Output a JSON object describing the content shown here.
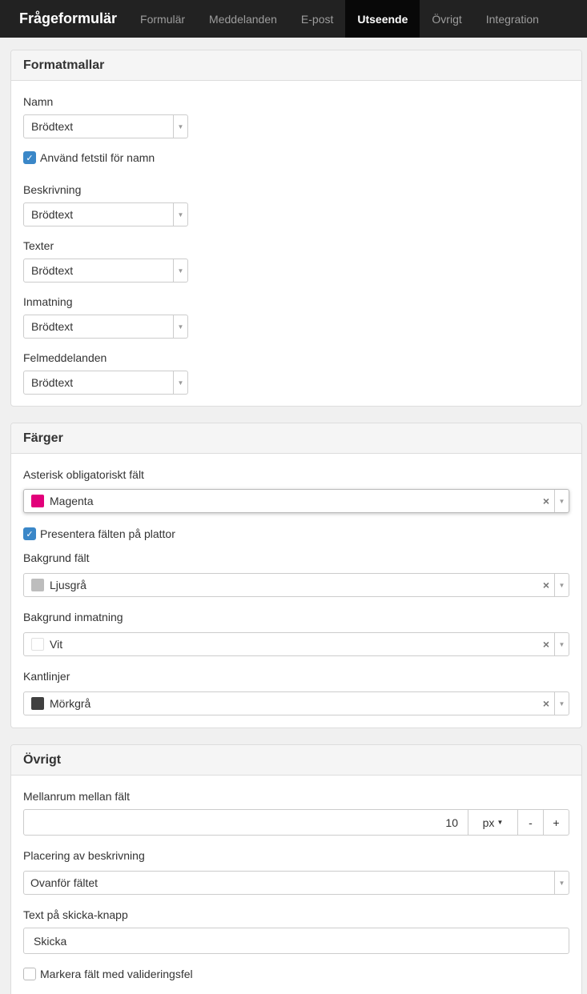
{
  "nav": {
    "brand": "Frågeformulär",
    "tabs": [
      "Formulär",
      "Meddelanden",
      "E-post",
      "Utseende",
      "Övrigt",
      "Integration"
    ]
  },
  "formatmallar": {
    "title": "Formatmallar",
    "namn_label": "Namn",
    "namn_value": "Brödtext",
    "bold_label": "Använd fetstil för namn",
    "beskrivning_label": "Beskrivning",
    "beskrivning_value": "Brödtext",
    "texter_label": "Texter",
    "texter_value": "Brödtext",
    "inmatning_label": "Inmatning",
    "inmatning_value": "Brödtext",
    "felmeddelanden_label": "Felmeddelanden",
    "felmeddelanden_value": "Brödtext"
  },
  "farger": {
    "title": "Färger",
    "asterisk_label": "Asterisk obligatoriskt fält",
    "asterisk_value": "Magenta",
    "asterisk_color": "#e2007a",
    "plattor_label": "Presentera fälten på plattor",
    "bakgrund_falt_label": "Bakgrund fält",
    "bakgrund_falt_value": "Ljusgrå",
    "bakgrund_falt_color": "#bdbdbd",
    "bakgrund_inmatning_label": "Bakgrund inmatning",
    "bakgrund_inmatning_value": "Vit",
    "bakgrund_inmatning_color": "#ffffff",
    "kantlinjer_label": "Kantlinjer",
    "kantlinjer_value": "Mörkgrå",
    "kantlinjer_color": "#404040",
    "clear_symbol": "×"
  },
  "ovrigt": {
    "title": "Övrigt",
    "mellanrum_label": "Mellanrum mellan fält",
    "mellanrum_value": "10",
    "mellanrum_unit": "px",
    "minus": "-",
    "plus": "+",
    "placering_label": "Placering av beskrivning",
    "placering_value": "Ovanför fältet",
    "skicka_label": "Text på skicka-knapp",
    "skicka_value": "Skicka",
    "validering_label": "Markera fält med valideringsfel"
  }
}
